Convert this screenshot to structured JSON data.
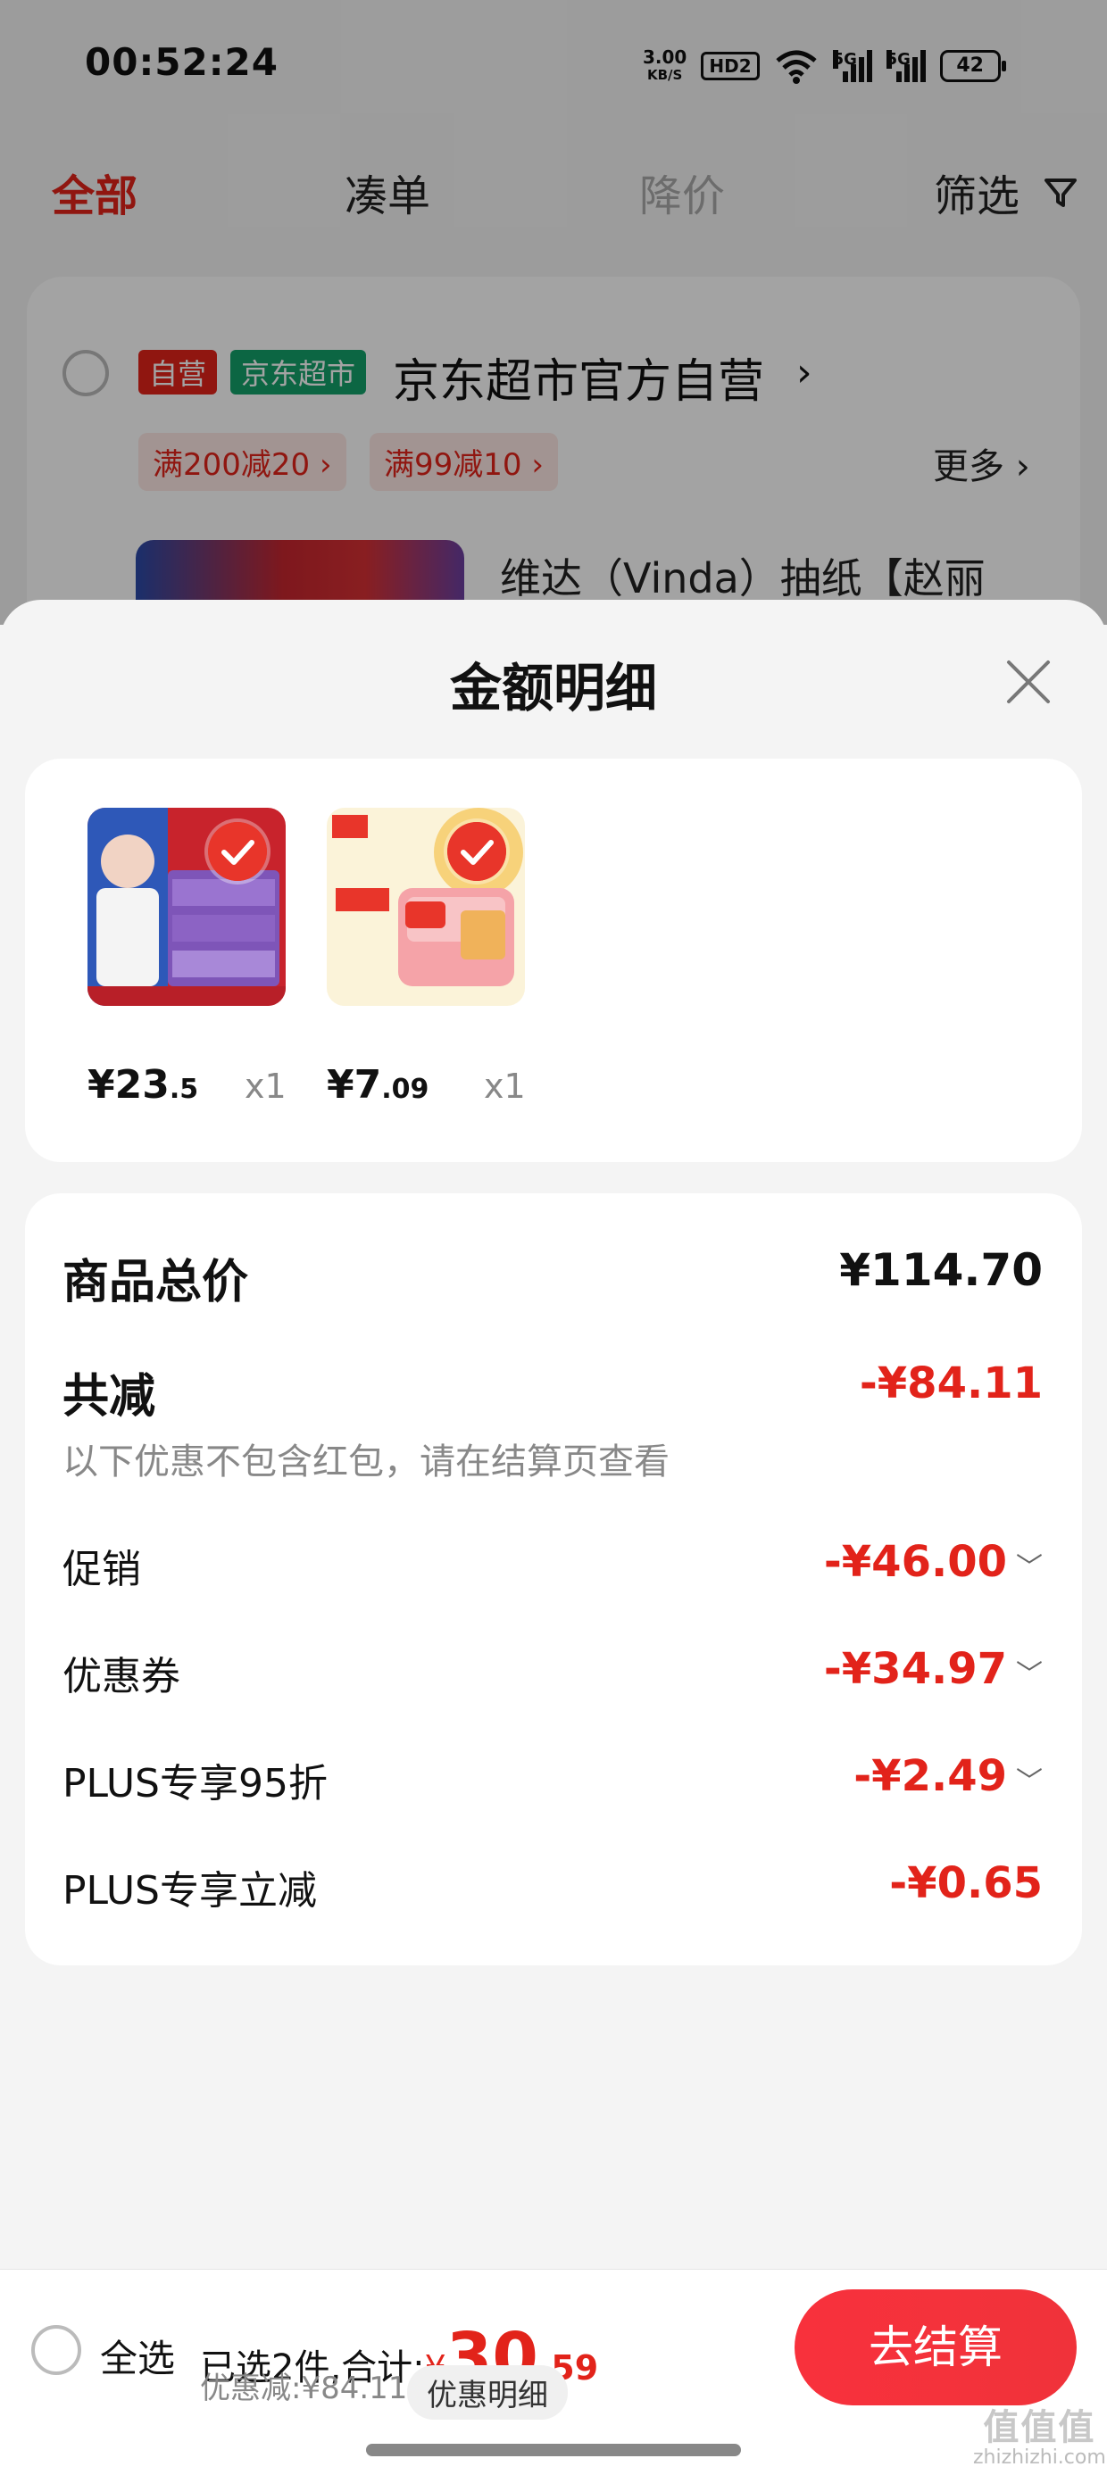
{
  "status_bar": {
    "time": "00:52:24",
    "net_speed_value": "3.00",
    "net_speed_unit": "KB/S",
    "hd_label": "HD2",
    "signal1_label": "5G",
    "signal2_label": "5G",
    "battery": "42"
  },
  "tabs": [
    {
      "label": "全部",
      "active": true
    },
    {
      "label": "凑单",
      "active": false
    },
    {
      "label": "降价",
      "active": false
    },
    {
      "label": "筛选",
      "active": false
    }
  ],
  "store": {
    "tag_self": "自营",
    "tag_market": "京东超市",
    "name": "京东超市官方自营",
    "chevron": "›",
    "promos": [
      "满200减20 ›",
      "满99减10 ›"
    ],
    "more": "更多 ›",
    "product_title": "维达（Vinda）抽纸【赵丽"
  },
  "sheet": {
    "title": "金额明细",
    "items": [
      {
        "price_int": "¥23",
        "price_dec": ".5",
        "qty": "x1"
      },
      {
        "price_int": "¥7",
        "price_dec": ".09",
        "qty": "x1"
      }
    ],
    "total_label": "商品总价",
    "total_value": "¥114.70",
    "reduce_label": "共减",
    "reduce_value": "-¥84.11",
    "reduce_note": "以下优惠不包含红包，请在结算页查看",
    "breakdown": [
      {
        "label": "促销",
        "value": "-¥46.00",
        "expandable": true
      },
      {
        "label": "优惠券",
        "value": "-¥34.97",
        "expandable": true
      },
      {
        "label": "PLUS专享95折",
        "value": "-¥2.49",
        "expandable": true
      },
      {
        "label": "PLUS专享立减",
        "value": "-¥0.65",
        "expandable": false
      }
    ]
  },
  "bottom": {
    "select_all": "全选",
    "summary_prefix": "已选2件,合计:",
    "currency": "¥",
    "total_int": "30",
    "total_dec": ".59",
    "discount": "优惠减:¥84.11",
    "detail_button": "优惠明细",
    "checkout": "去结算",
    "watermark_brand": "值值值",
    "watermark_site": "zhizhizhi.com"
  },
  "colors": {
    "accent": "#e2231a",
    "green_tag": "#13a06a"
  }
}
